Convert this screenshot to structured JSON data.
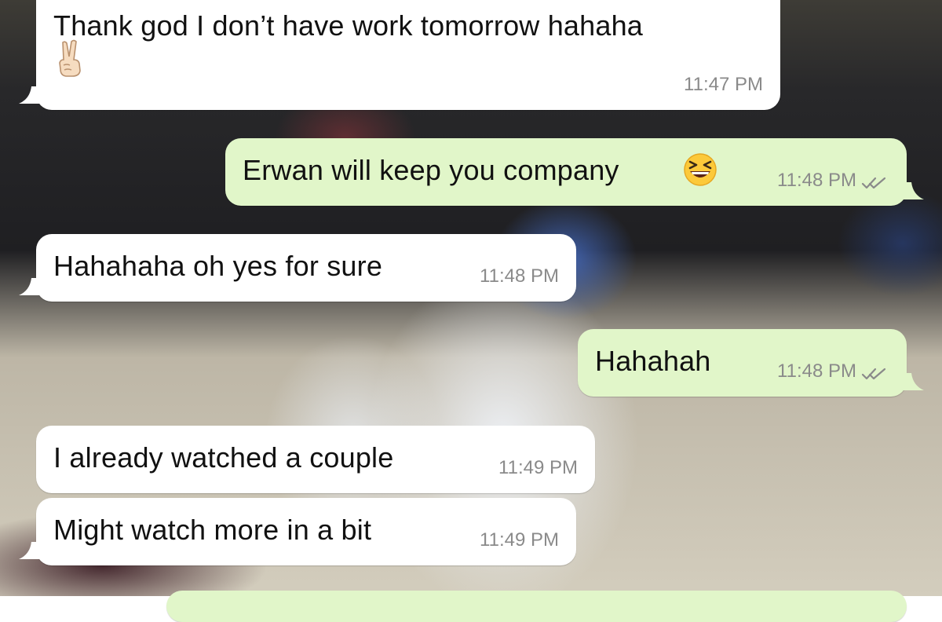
{
  "chat": {
    "messages": [
      {
        "direction": "incoming",
        "text": "Thank god I don’t have work tomorrow hahaha",
        "emoji": "victory-hand",
        "time": "11:47 PM"
      },
      {
        "direction": "outgoing",
        "text": "Erwan will keep you company",
        "emoji": "grinning-squinting-face",
        "time": "11:48 PM",
        "status": "read"
      },
      {
        "direction": "incoming",
        "text": "Hahahaha oh yes for sure",
        "time": "11:48 PM"
      },
      {
        "direction": "outgoing",
        "text": "Hahahah",
        "time": "11:48 PM",
        "status": "read"
      },
      {
        "direction": "incoming",
        "text": "I already watched a couple",
        "time": "11:49 PM"
      },
      {
        "direction": "incoming",
        "text": "Might watch more in a bit",
        "time": "11:49 PM"
      }
    ]
  },
  "colors": {
    "incoming_bubble": "#ffffff",
    "outgoing_bubble": "#e1f6c9",
    "timestamp": "#8a8a8a",
    "read_ticks": "#8a8a8a"
  }
}
